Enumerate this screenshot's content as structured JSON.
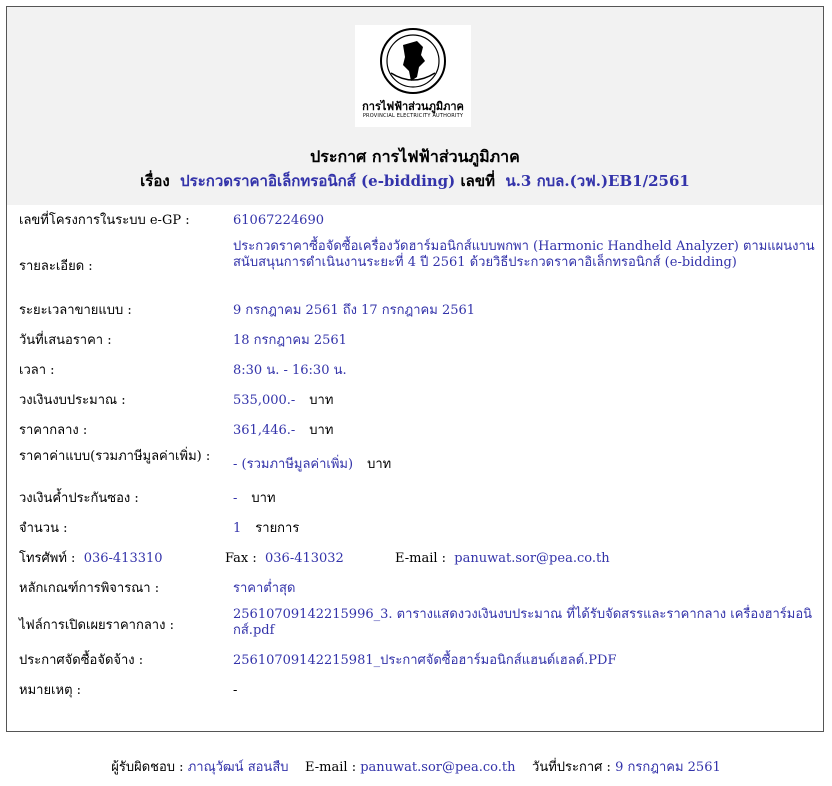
{
  "logo": {
    "name_th": "การไฟฟ้าส่วนภูมิภาค",
    "name_en": "PROVINCIAL ELECTRICITY AUTHORITY"
  },
  "header": {
    "title": "ประกาศ การไฟฟ้าส่วนภูมิภาค",
    "subject_label": "เรื่อง",
    "subject": "ประกวดราคาอิเล็กทรอนิกส์ (e-bidding)",
    "number_label": "เลขที่",
    "number": "น.3 กบล.(วฟ.)EB1/2561"
  },
  "details": {
    "project_id_label": "เลขที่โครงการในระบบ e-GP :",
    "project_id": "61067224690",
    "description_label": "รายละเอียด :",
    "description": "ประกวดราคาซื้อจัดซื้อเครื่องวัดฮาร์มอนิกส์แบบพกพา (Harmonic Handheld Analyzer) ตามแผนงานสนับสนุนการดำเนินงานระยะที่ 4 ปี 2561 ด้วยวิธีประกวดราคาอิเล็กทรอนิกส์ (e-bidding)",
    "sale_period_label": "ระยะเวลาขายแบบ :",
    "sale_period": "9 กรกฎาคม 2561 ถึง 17 กรกฎาคม 2561",
    "bid_date_label": "วันที่เสนอราคา :",
    "bid_date": "18 กรกฎาคม 2561",
    "time_label": "เวลา :",
    "time": "8:30 น. - 16:30 น.",
    "budget_label": "วงเงินงบประมาณ :",
    "budget": "535,000.-",
    "budget_unit": "บาท",
    "median_price_label": "ราคากลาง :",
    "median_price": "361,446.-",
    "median_price_unit": "บาท",
    "doc_price_label": "ราคาค่าแบบ(รวมภาษีมูลค่าเพิ่ม) :",
    "doc_price": "- (รวมภาษีมูลค่าเพิ่ม)",
    "doc_price_unit": "บาท",
    "guarantee_label": "วงเงินค้ำประกันซอง :",
    "guarantee": "-",
    "guarantee_unit": "บาท",
    "quantity_label": "จำนวน :",
    "quantity": "1",
    "quantity_unit": "รายการ",
    "phone_label": "โทรศัพท์ :",
    "phone": "036-413310",
    "fax_label": "Fax :",
    "fax": "036-413032",
    "email_label": "E-mail :",
    "email": "panuwat.sor@pea.co.th",
    "criteria_label": "หลักเกณฑ์การพิจารณา :",
    "criteria": "ราคาต่ำสุด",
    "disclosure_file_label": "ไฟล์การเปิดเผยราคากลาง :",
    "disclosure_file": "25610709142215996_3. ตารางแสดงวงเงินงบประมาณ ที่ได้รับจัดสรรและราคากลาง เครื่องฮาร์มอนิกส์.pdf",
    "announcement_label": "ประกาศจัดซื้อจัดจ้าง :",
    "announcement_file": "25610709142215981_ประกาศจัดซื้อฮาร์มอนิกส์แฮนด์เฮลด์.PDF",
    "note_label": "หมายเหตุ :",
    "note": "-"
  },
  "footer": {
    "responsible_label": "ผู้รับผิดชอบ :",
    "responsible": "ภาณุวัฒน์ สอนสืบ",
    "email_label": "E-mail :",
    "email": "panuwat.sor@pea.co.th",
    "date_label": "วันที่ประกาศ :",
    "date": "9 กรกฎาคม 2561"
  }
}
